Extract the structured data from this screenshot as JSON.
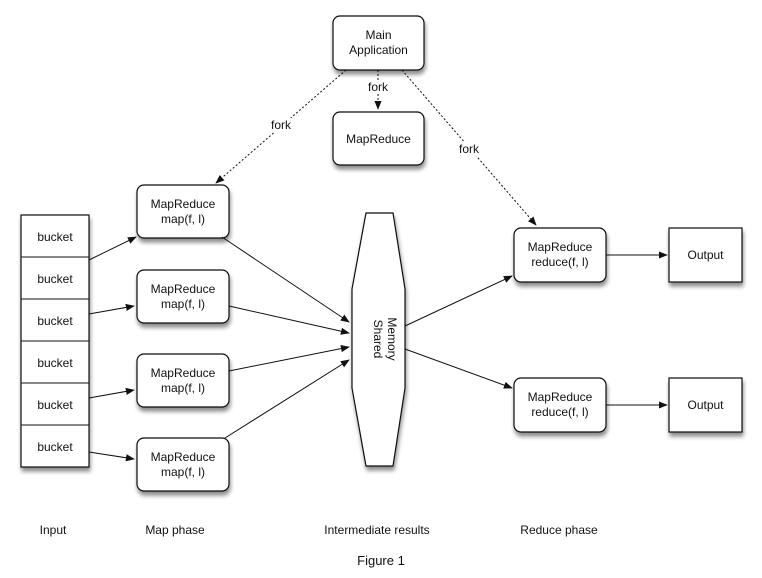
{
  "main_application": {
    "lines": [
      "Main",
      "Application"
    ]
  },
  "mapreduce_master": {
    "label": "MapReduce"
  },
  "fork_labels": [
    "fork",
    "fork",
    "fork"
  ],
  "input": {
    "buckets": [
      "bucket",
      "bucket",
      "bucket",
      "bucket",
      "bucket",
      "bucket"
    ]
  },
  "mappers": [
    {
      "lines": [
        "MapReduce",
        "map(f, l)"
      ]
    },
    {
      "lines": [
        "MapReduce",
        "map(f, l)"
      ]
    },
    {
      "lines": [
        "MapReduce",
        "map(f, l)"
      ]
    },
    {
      "lines": [
        "MapReduce",
        "map(f, l)"
      ]
    }
  ],
  "shared_memory": {
    "lines": [
      "Shared",
      "Memory"
    ]
  },
  "reducers": [
    {
      "lines": [
        "MapReduce",
        "reduce(f, l)"
      ]
    },
    {
      "lines": [
        "MapReduce",
        "reduce(f, l)"
      ]
    }
  ],
  "outputs": [
    {
      "label": "Output"
    },
    {
      "label": "Output"
    }
  ],
  "phase_captions": {
    "input": "Input",
    "map": "Map phase",
    "intermediate": "Intermediate results",
    "reduce": "Reduce phase"
  },
  "figure_caption": "Figure 1"
}
